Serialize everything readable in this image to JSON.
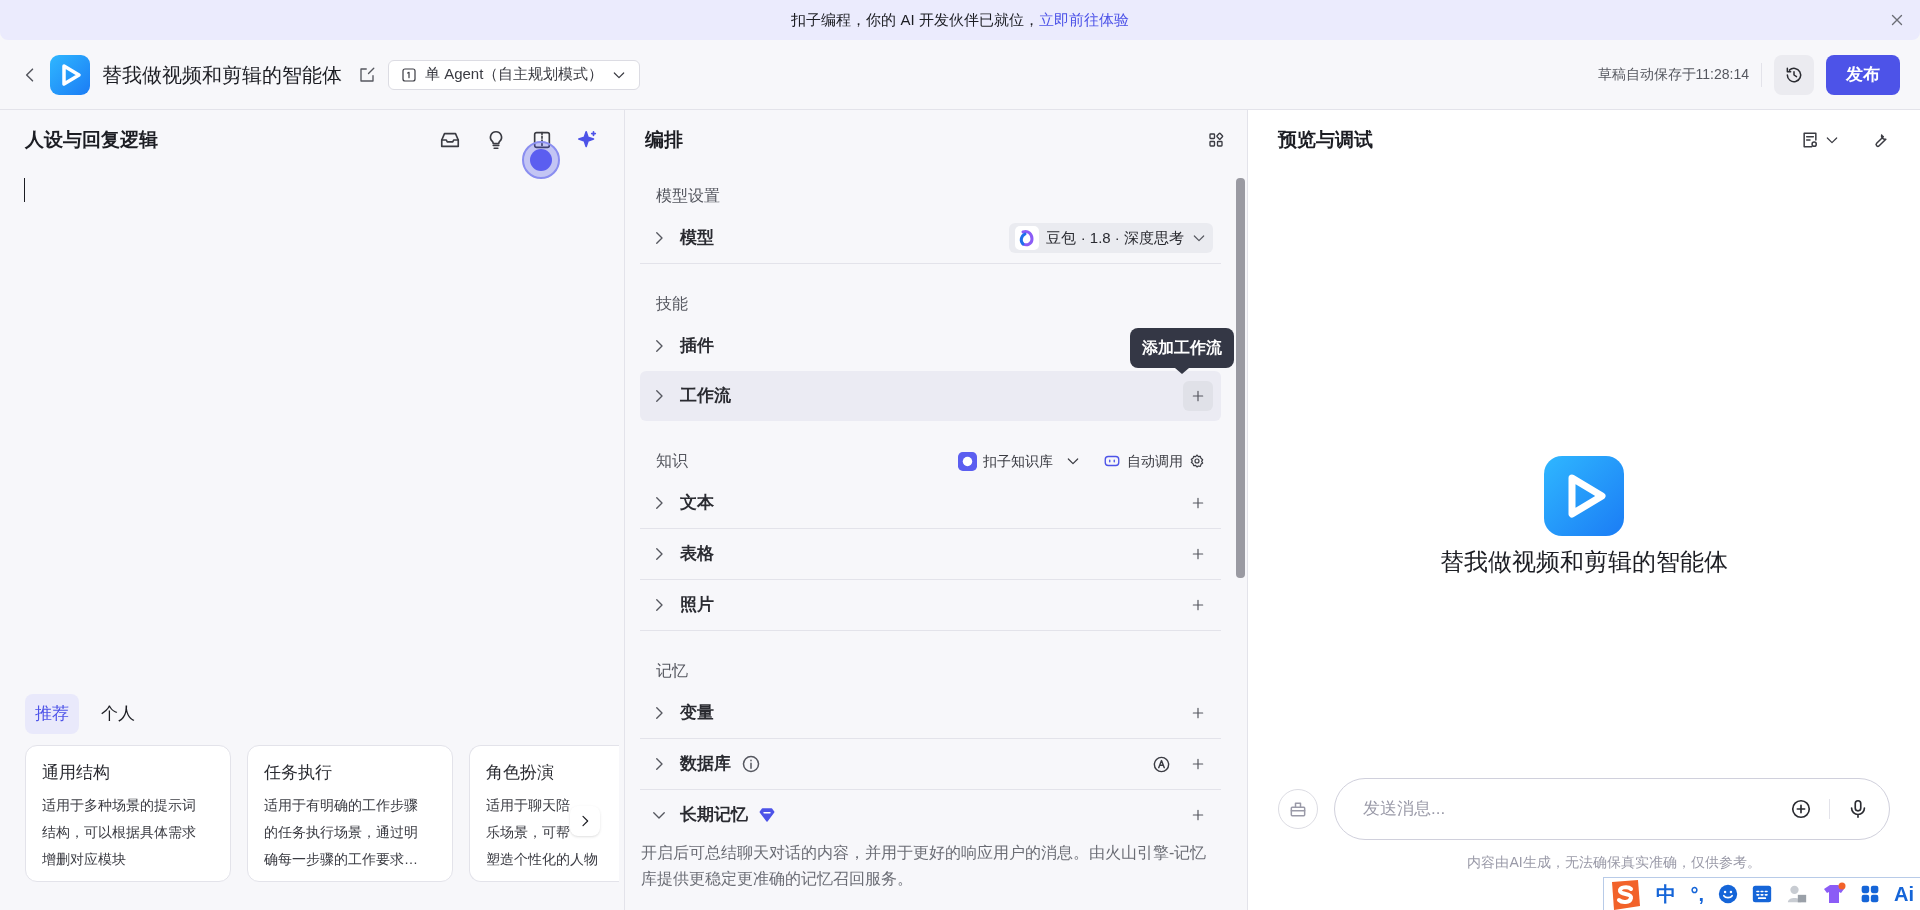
{
  "banner": {
    "text": "扣子编程，你的 AI 开发伙伴已就位，",
    "link": "立即前往体验"
  },
  "header": {
    "title": "替我做视频和剪辑的智能体",
    "agent_mode": "单 Agent（自主规划模式）",
    "autosave": "草稿自动保存于11:28:14",
    "publish": "发布"
  },
  "persona": {
    "title": "人设与回复逻辑",
    "tabs": [
      {
        "label": "推荐",
        "selected": true
      },
      {
        "label": "个人",
        "selected": false
      }
    ],
    "cards": [
      {
        "title": "通用结构",
        "lines": [
          "适用于多种场景的提示词",
          "结构，可以根据具体需求",
          "增删对应模块"
        ]
      },
      {
        "title": "任务执行",
        "lines": [
          "适用于有明确的工作步骤",
          "的任务执行场景，通过明",
          "确每一步骤的工作要求…"
        ]
      },
      {
        "title": "角色扮演",
        "lines": [
          "适用于聊天陪",
          "乐场景，可帮",
          "塑造个性化的人物"
        ]
      }
    ]
  },
  "arrangement": {
    "title": "编排",
    "tooltip": "添加工作流",
    "sections": [
      {
        "heading": "模型设置",
        "divided": true,
        "items": [
          {
            "label": "模型",
            "expanded": false,
            "value": "豆包 · 1.8 · 深度思考",
            "add": false
          }
        ]
      },
      {
        "heading": "技能",
        "divided": false,
        "items": [
          {
            "label": "插件",
            "expanded": false,
            "add": false
          },
          {
            "label": "工作流",
            "expanded": false,
            "add": true,
            "highlighted": true
          }
        ]
      },
      {
        "heading": "知识",
        "divided": true,
        "source": "扣子知识库",
        "mode": "自动调用",
        "items": [
          {
            "label": "文本",
            "expanded": false,
            "add": true
          },
          {
            "label": "表格",
            "expanded": false,
            "add": true
          },
          {
            "label": "照片",
            "expanded": false,
            "add": true
          }
        ]
      },
      {
        "heading": "记忆",
        "divided": true,
        "items": [
          {
            "label": "变量",
            "expanded": false,
            "add": true
          },
          {
            "label": "数据库",
            "expanded": false,
            "add": true,
            "info": true,
            "auto": true
          },
          {
            "label": "长期记忆",
            "expanded": true,
            "add": true,
            "premium": true,
            "description": "开启后可总结聊天对话的内容，并用于更好的响应用户的消息。由火山引擎-记忆库提供更稳定更准确的记忆召回服务。"
          }
        ]
      }
    ]
  },
  "preview": {
    "title": "预览与调试",
    "agent_name": "替我做视频和剪辑的智能体",
    "placeholder": "发送消息...",
    "disclaimer": "内容由AI生成，无法确保真实准确，仅供参考。"
  },
  "ime": [
    {
      "kind": "logo"
    },
    {
      "kind": "text",
      "label": "中"
    },
    {
      "kind": "text",
      "label": "°,"
    },
    {
      "kind": "smile"
    },
    {
      "kind": "keyboard"
    },
    {
      "kind": "person"
    },
    {
      "kind": "shirt"
    },
    {
      "kind": "grid"
    },
    {
      "kind": "text",
      "label": "Ai"
    }
  ]
}
